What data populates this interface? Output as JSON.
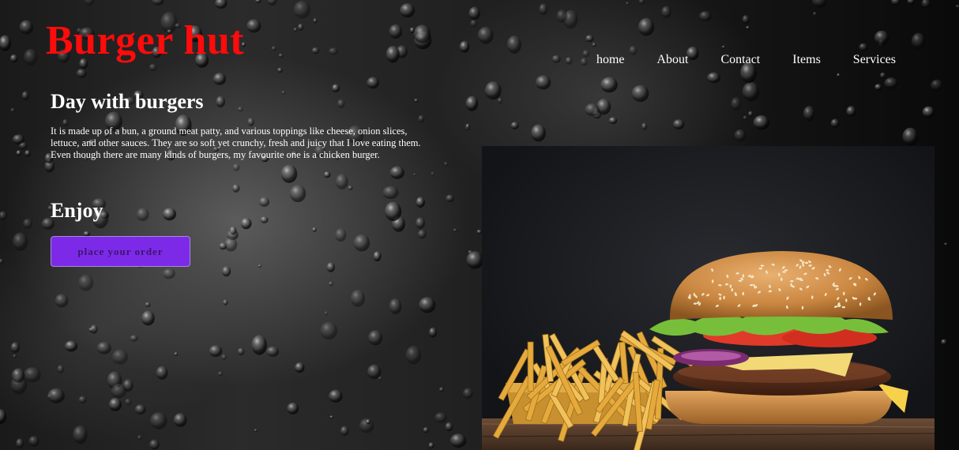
{
  "brand": {
    "title": "Burger hut",
    "color": "#ff0b0b"
  },
  "nav": {
    "items": [
      {
        "label": "home"
      },
      {
        "label": "About"
      },
      {
        "label": "Contact"
      },
      {
        "label": "Items"
      },
      {
        "label": "Services"
      }
    ]
  },
  "hero": {
    "heading": "Day with burgers",
    "description": "It is made up of a bun, a ground meat patty, and various toppings like cheese, onion slices, lettuce, and other sauces. They are so soft yet crunchy, fresh and juicy that I love eating them. Even though there are many kinds of burgers, my favourite one is a chicken burger.",
    "subheading": "Enjoy",
    "cta_label": "place your order",
    "cta_color": "#7c2ae8"
  },
  "image": {
    "subject": "burger-and-fries-photo"
  },
  "background": {
    "subject": "water-droplets-on-glass"
  }
}
